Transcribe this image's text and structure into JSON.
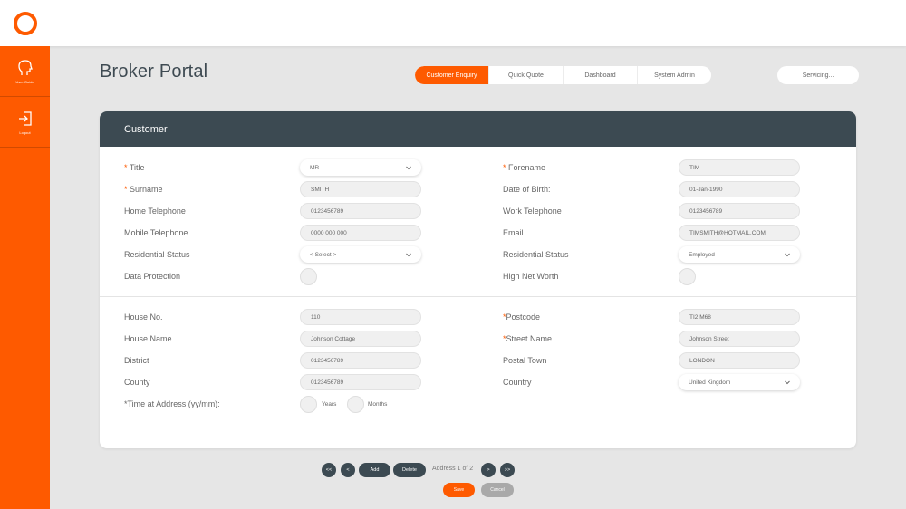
{
  "app": {
    "title": "Broker Portal",
    "brand_color": "#fe5a00",
    "header_color": "#3c4a52"
  },
  "sidebar": {
    "items": [
      {
        "label": "User Guide",
        "icon": "head-icon"
      },
      {
        "label": "Logout",
        "icon": "logout-icon"
      }
    ]
  },
  "nav": {
    "tabs": [
      {
        "label": "Customer Enquiry",
        "active": true
      },
      {
        "label": "Quick Quote",
        "active": false
      },
      {
        "label": "Dashboard",
        "active": false
      },
      {
        "label": "System Admin",
        "active": false
      }
    ],
    "servicing": "Servicing..."
  },
  "customer": {
    "header": "Customer",
    "title_label": "Title",
    "title_value": "MR",
    "forename_label": "Forename",
    "forename_value": "TIM",
    "surname_label": "Surname",
    "surname_value": "SMITH",
    "dob_label": "Date of Birth:",
    "dob_value": "01-Jan-1990",
    "home_tel_label": "Home Telephone",
    "home_tel_value": "0123456789",
    "work_tel_label": "Work Telephone",
    "work_tel_value": "0123456789",
    "mobile_label": "Mobile Telephone",
    "mobile_value": "0000 000 000",
    "email_label": "Email",
    "email_value": "TIMSMITH@HOTMAIL.COM",
    "res_status_label": "Residential Status",
    "res_status_value": "< Select >",
    "res_status2_label": "Residential Status",
    "res_status2_value": "Employed",
    "data_protection_label": "Data Protection",
    "hnw_label": "High Net Worth"
  },
  "address": {
    "house_no_label": "House No.",
    "house_no_value": "110",
    "postcode_label": "Postcode",
    "postcode_value": "TI2 M68",
    "house_name_label": "House Name",
    "house_name_value": "Johnson Cottage",
    "street_label": "Street Name",
    "street_value": "Johnson Street",
    "district_label": "District",
    "district_value": "0123456789",
    "town_label": "Postal Town",
    "town_value": "LONDON",
    "county_label": "County",
    "county_value": "0123456789",
    "country_label": "Country",
    "country_value": "United Kingdom",
    "time_label": "*Time at Address (yy/mm):",
    "years_label": "Years",
    "months_label": "Months"
  },
  "pager": {
    "first": "<<",
    "prev": "<",
    "add": "Add",
    "delete": "Delete",
    "status": "Address 1 of 2",
    "next": ">",
    "last": ">>"
  },
  "actions": {
    "save": "Save",
    "cancel": "Cancel"
  }
}
